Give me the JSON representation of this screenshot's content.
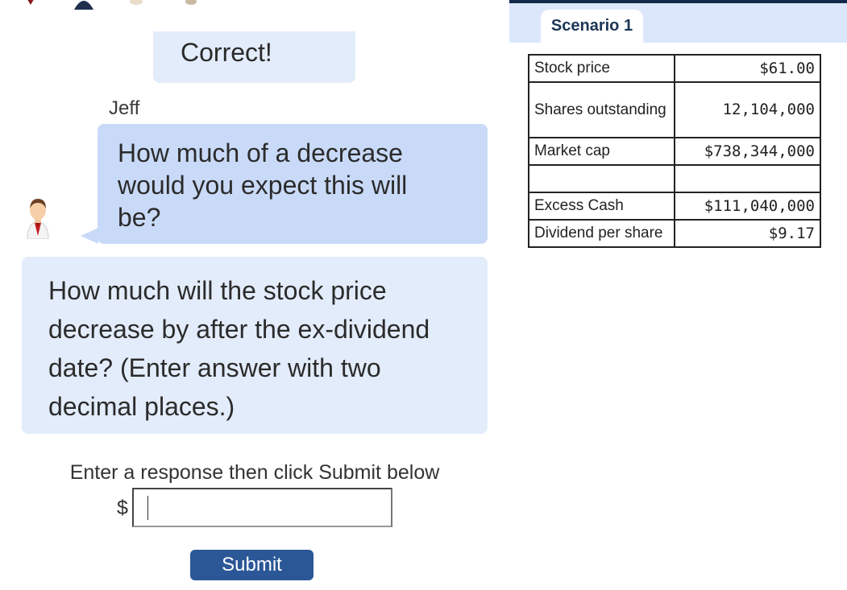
{
  "chat": {
    "feedback": "Correct!",
    "speaker": "Jeff",
    "question": "How much of a decrease would you expect this will be?",
    "prompt_text": "How much will the stock price decrease by after the ex-dividend date? (Enter answer with two decimal places.)"
  },
  "response": {
    "instruction": "Enter a response then click Submit below",
    "currency_symbol": "$",
    "value": "",
    "submit_label": "Submit"
  },
  "scenario": {
    "tab_label": "Scenario 1",
    "rows": [
      {
        "label": "Stock price",
        "value": "$61.00"
      },
      {
        "label": "Shares outstanding",
        "value": "12,104,000"
      },
      {
        "label": "Market cap",
        "value": "$738,344,000"
      },
      {
        "label": "",
        "value": ""
      },
      {
        "label": "Excess Cash",
        "value": "$111,040,000"
      },
      {
        "label": "Dividend per share",
        "value": "$9.17"
      }
    ]
  },
  "colors": {
    "accent": "#2b5797",
    "bubble_light": "#e3ecfb",
    "bubble_blue": "#c9daf8",
    "panel_bar": "#13294b"
  }
}
